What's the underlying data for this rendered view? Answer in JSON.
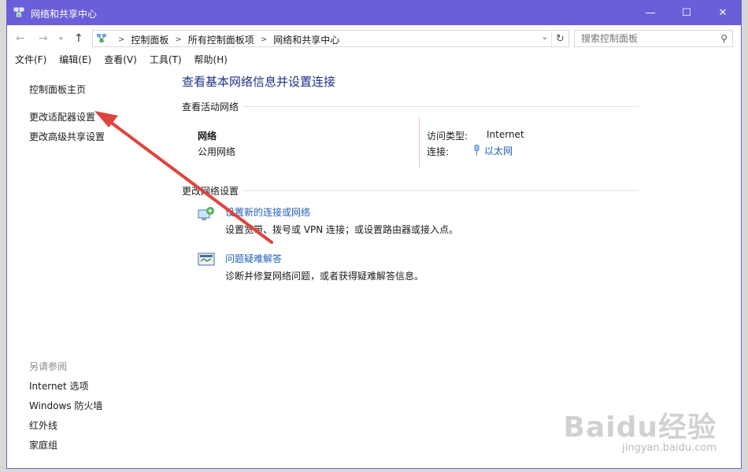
{
  "window": {
    "title": "网络和共享中心",
    "controls": {
      "minimize": "—",
      "maximize": "☐",
      "close": "✕"
    }
  },
  "navigation": {
    "back": "←",
    "forward": "→",
    "up": "↑",
    "breadcrumbs": [
      "控制面板",
      "所有控制面板项",
      "网络和共享中心"
    ],
    "breadcrumb_separator": ">",
    "refresh": "↻"
  },
  "search": {
    "placeholder": "搜索控制面板",
    "value": ""
  },
  "menu": [
    "文件(F)",
    "编辑(E)",
    "查看(V)",
    "工具(T)",
    "帮助(H)"
  ],
  "sidebar": {
    "items": [
      {
        "label": "控制面板主页"
      },
      {
        "label": "更改适配器设置"
      },
      {
        "label": "更改高级共享设置"
      }
    ],
    "see_also_title": "另请参阅",
    "see_also": [
      {
        "label": "Internet 选项"
      },
      {
        "label": "Windows 防火墙"
      },
      {
        "label": "红外线"
      },
      {
        "label": "家庭组"
      }
    ]
  },
  "main": {
    "heading": "查看基本网络信息并设置连接",
    "active_networks_title": "查看活动网络",
    "network": {
      "name": "网络",
      "type": "公用网络",
      "access_type_label": "访问类型:",
      "access_type_value": "Internet",
      "connections_label": "连接:",
      "connections_value": "以太网"
    },
    "change_settings_title": "更改网络设置",
    "tasks": [
      {
        "link": "设置新的连接或网络",
        "desc": "设置宽带、拨号或 VPN 连接；或设置路由器或接入点。"
      },
      {
        "link": "问题疑难解答",
        "desc": "诊断并修复网络问题，或者获得疑难解答信息。"
      }
    ]
  },
  "watermark": {
    "brand": "Baidu经验",
    "url": "jingyan.baidu.com"
  },
  "colors": {
    "titlebar": "#6b5fd9",
    "link": "#1f5fb5",
    "heading": "#1e3287",
    "arrow": "#e0433c"
  }
}
